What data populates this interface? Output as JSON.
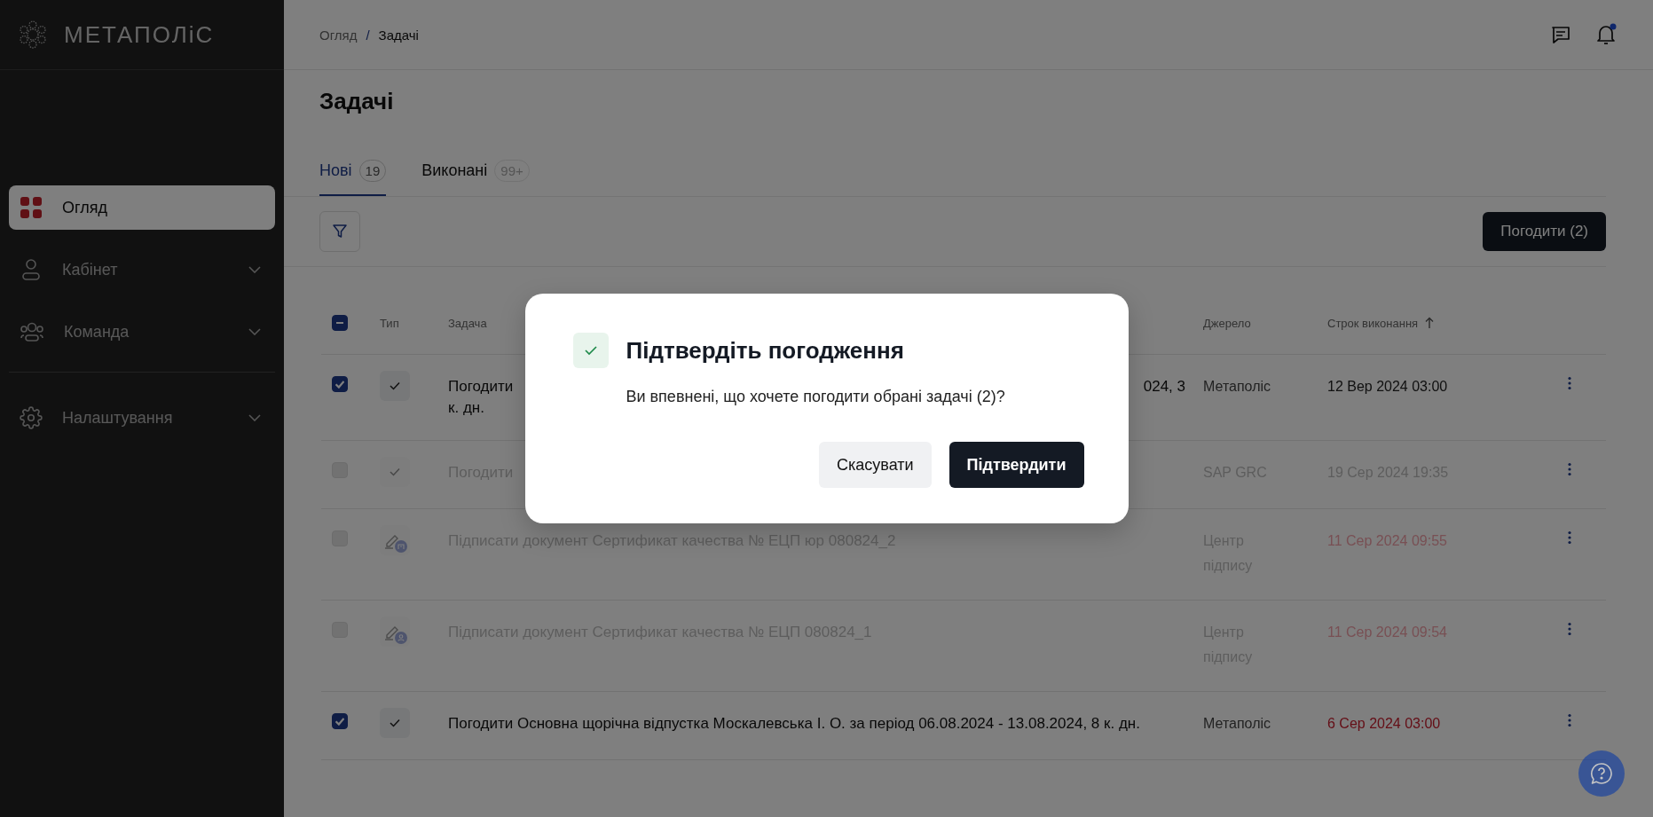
{
  "sidebar": {
    "logo": "МЕТАПОЛіС",
    "items": [
      {
        "label": "Огляд",
        "selected": true,
        "expandable": false
      },
      {
        "label": "Кабінет",
        "selected": false,
        "expandable": true
      },
      {
        "label": "Команда",
        "selected": false,
        "expandable": true
      },
      {
        "label": "Налаштування",
        "selected": false,
        "expandable": true
      }
    ]
  },
  "header": {
    "breadcrumb": [
      "Огляд",
      "Задачі"
    ],
    "separator": "/",
    "unread": true
  },
  "page_title": "Задачі",
  "tabs": [
    {
      "label": "Нові",
      "count": "19",
      "selected": true
    },
    {
      "label": "Виконані",
      "count": "99+",
      "selected": false
    }
  ],
  "toolbar": {
    "approve_button": "Погодити (2)"
  },
  "table": {
    "select_all_partial": true,
    "columns": [
      "Тип",
      "Задача",
      "Джерело",
      "Строк виконання"
    ],
    "rows": [
      {
        "kind": "approval",
        "selected": true,
        "disabled": false,
        "overdue": false,
        "task_lines": [
          [
            "Погодити",
            "024, 3"
          ],
          [
            "к. дн."
          ]
        ],
        "source": "Метаполіс",
        "due": "12 Вер 2024 03:00"
      },
      {
        "kind": "approval",
        "selected": false,
        "disabled": true,
        "overdue": false,
        "task_lines": [
          [
            "Погодити"
          ]
        ],
        "source": "SAP GRC",
        "due": "19 Сер 2024 19:35"
      },
      {
        "kind": "signature-company",
        "selected": false,
        "disabled": true,
        "overdue": true,
        "task_lines": [
          [
            "Підписати документ Сертификат качества № ЕЦП юр 080824_2"
          ]
        ],
        "source": "Центр підпису",
        "due": "11 Сер 2024 09:55"
      },
      {
        "kind": "signature-person",
        "selected": false,
        "disabled": true,
        "overdue": true,
        "task_lines": [
          [
            "Підписати документ Сертификат качества № ЕЦП 080824_1"
          ]
        ],
        "source": "Центр підпису",
        "due": "11 Сер 2024 09:54"
      },
      {
        "kind": "approval",
        "selected": true,
        "disabled": false,
        "overdue": true,
        "task_lines": [
          [
            "Погодити Основна щорічна відпустка Москалевська І. О. за період 06.08.2024 - 13.08.2024, 8 к. дн."
          ]
        ],
        "source": "Метаполіс",
        "due": "6 Сер 2024 03:00"
      }
    ]
  },
  "dialog": {
    "title": "Підтвердіть погодження",
    "message": "Ви впевнені, що хочете погодити обрані задачі (2)?",
    "cancel": "Скасувати",
    "confirm": "Підтвердити"
  }
}
